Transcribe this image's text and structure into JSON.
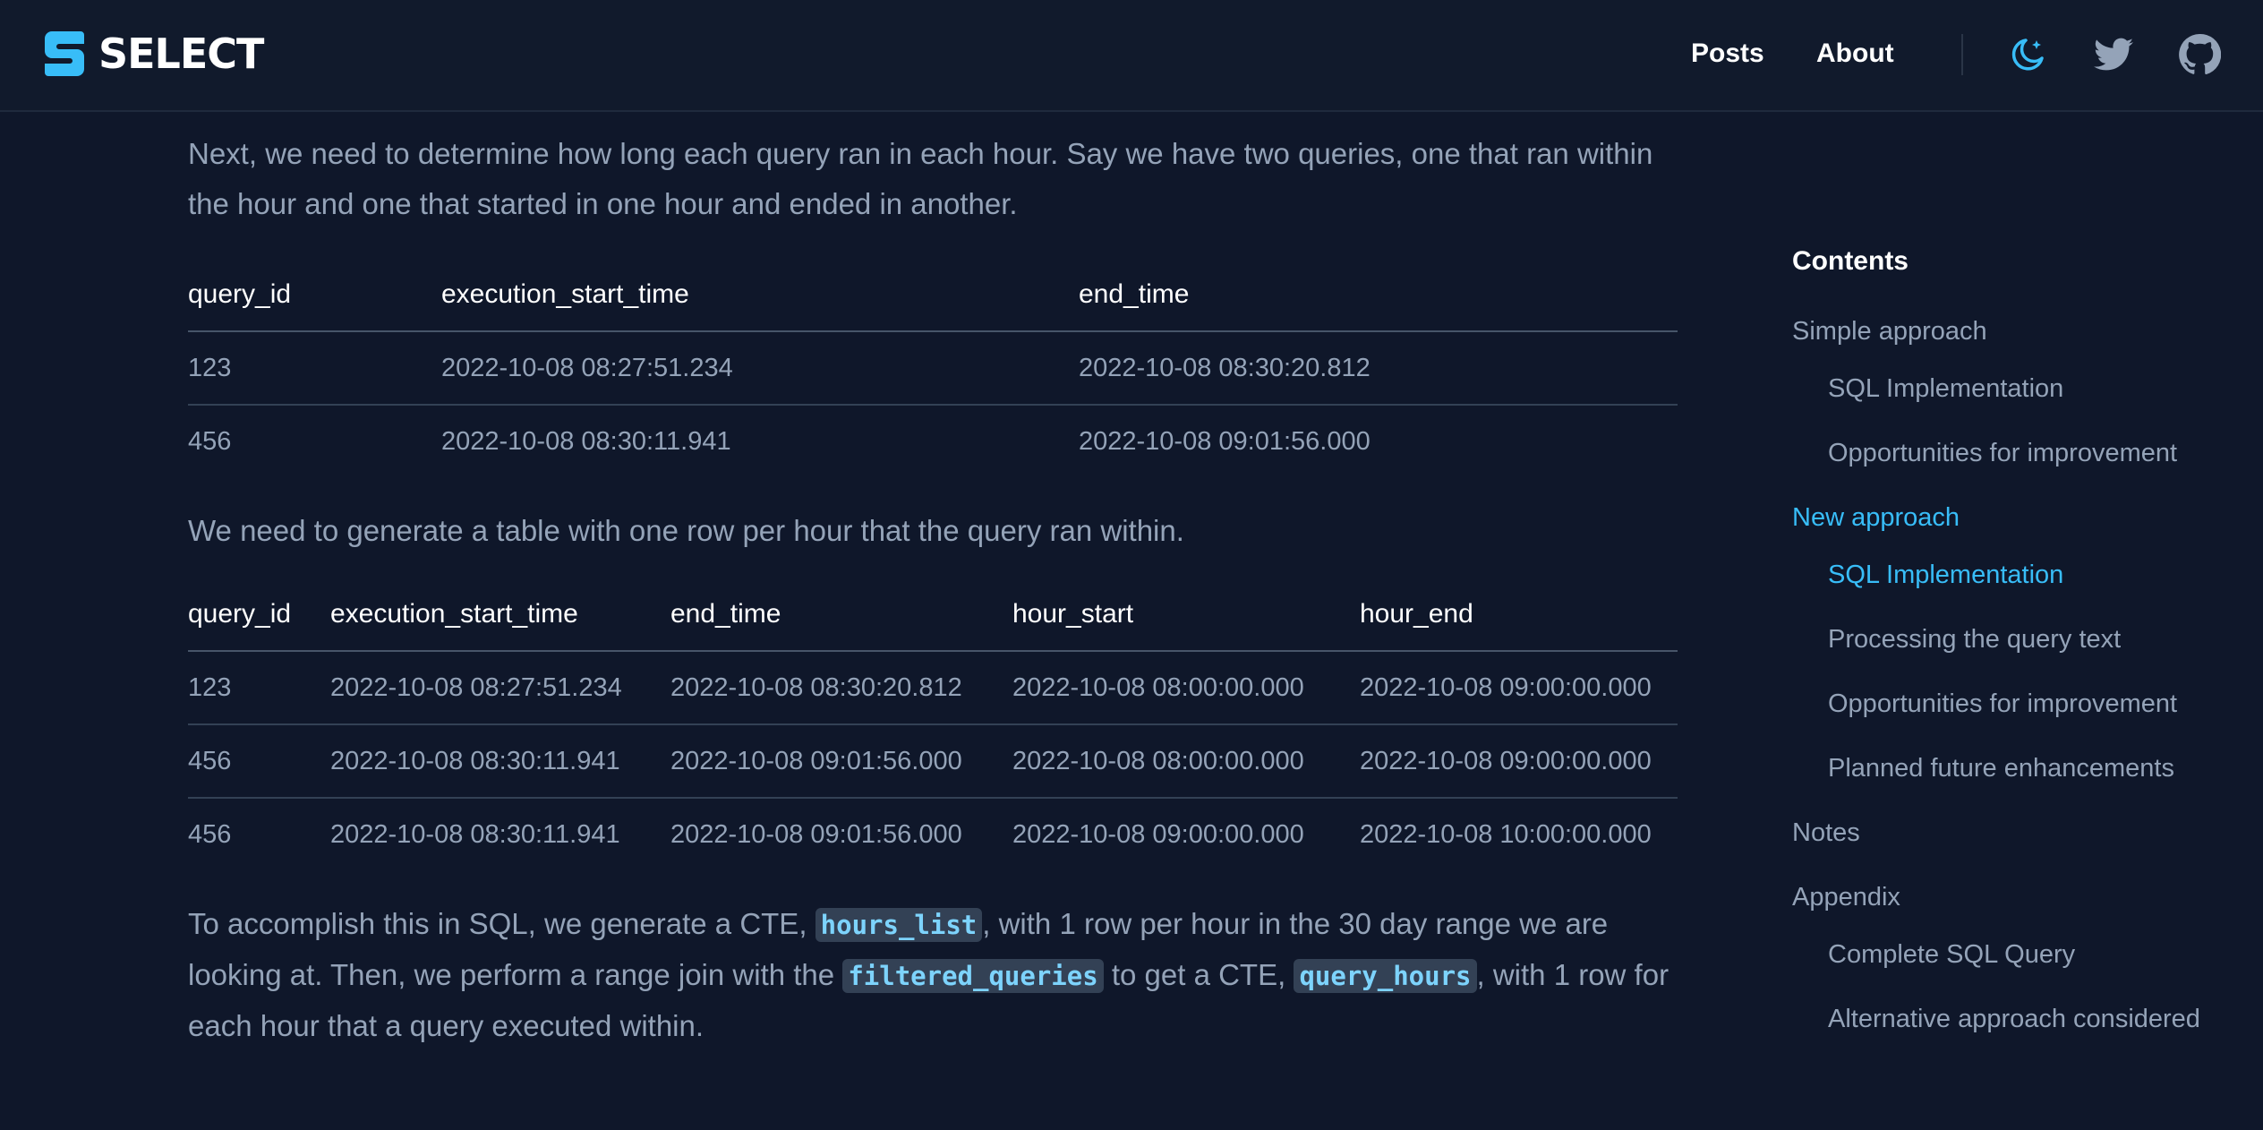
{
  "header": {
    "brand": "SELECT",
    "nav": [
      "Posts",
      "About"
    ],
    "icons": [
      "theme-toggle-icon",
      "twitter-icon",
      "github-icon"
    ],
    "accent_color": "#38bdf8"
  },
  "article": {
    "para1": "Next, we need to determine how long each query ran in each hour. Say we have two queries, one that ran within the hour and one that started in one hour and ended in another.",
    "table1": {
      "headers": [
        "query_id",
        "execution_start_time",
        "end_time"
      ],
      "rows": [
        [
          "123",
          "2022-10-08 08:27:51.234",
          "2022-10-08 08:30:20.812"
        ],
        [
          "456",
          "2022-10-08 08:30:11.941",
          "2022-10-08 09:01:56.000"
        ]
      ]
    },
    "para2": "We need to generate a table with one row per hour that the query ran within.",
    "table2": {
      "headers": [
        "query_id",
        "execution_start_time",
        "end_time",
        "hour_start",
        "hour_end"
      ],
      "rows": [
        [
          "123",
          "2022-10-08 08:27:51.234",
          "2022-10-08 08:30:20.812",
          "2022-10-08 08:00:00.000",
          "2022-10-08 09:00:00.000"
        ],
        [
          "456",
          "2022-10-08 08:30:11.941",
          "2022-10-08 09:01:56.000",
          "2022-10-08 08:00:00.000",
          "2022-10-08 09:00:00.000"
        ],
        [
          "456",
          "2022-10-08 08:30:11.941",
          "2022-10-08 09:01:56.000",
          "2022-10-08 09:00:00.000",
          "2022-10-08 10:00:00.000"
        ]
      ]
    },
    "para3": {
      "t1": "To accomplish this in SQL, we generate a CTE, ",
      "code1": "hours_list",
      "t2": ", with 1 row per hour in the 30 day range we are looking at. Then, we perform a range join with the ",
      "code2": "filtered_queries",
      "t3": " to get a CTE, ",
      "code3": "query_hours",
      "t4": ", with 1 row for each hour that a query executed within."
    }
  },
  "toc": {
    "title": "Contents",
    "items": [
      {
        "label": "Simple approach",
        "level": 1,
        "active": false
      },
      {
        "label": "SQL Implementation",
        "level": 2,
        "active": false
      },
      {
        "label": "Opportunities for improvement",
        "level": 2,
        "active": false
      },
      {
        "label": "New approach",
        "level": 1,
        "active": true
      },
      {
        "label": "SQL Implementation",
        "level": 2,
        "active": true
      },
      {
        "label": "Processing the query text",
        "level": 2,
        "active": false
      },
      {
        "label": "Opportunities for improvement",
        "level": 2,
        "active": false
      },
      {
        "label": "Planned future enhancements",
        "level": 2,
        "active": false
      },
      {
        "label": "Notes",
        "level": 1,
        "active": false
      },
      {
        "label": "Appendix",
        "level": 1,
        "active": false
      },
      {
        "label": "Complete SQL Query",
        "level": 2,
        "active": false
      },
      {
        "label": "Alternative approach considered",
        "level": 2,
        "active": false
      }
    ]
  }
}
